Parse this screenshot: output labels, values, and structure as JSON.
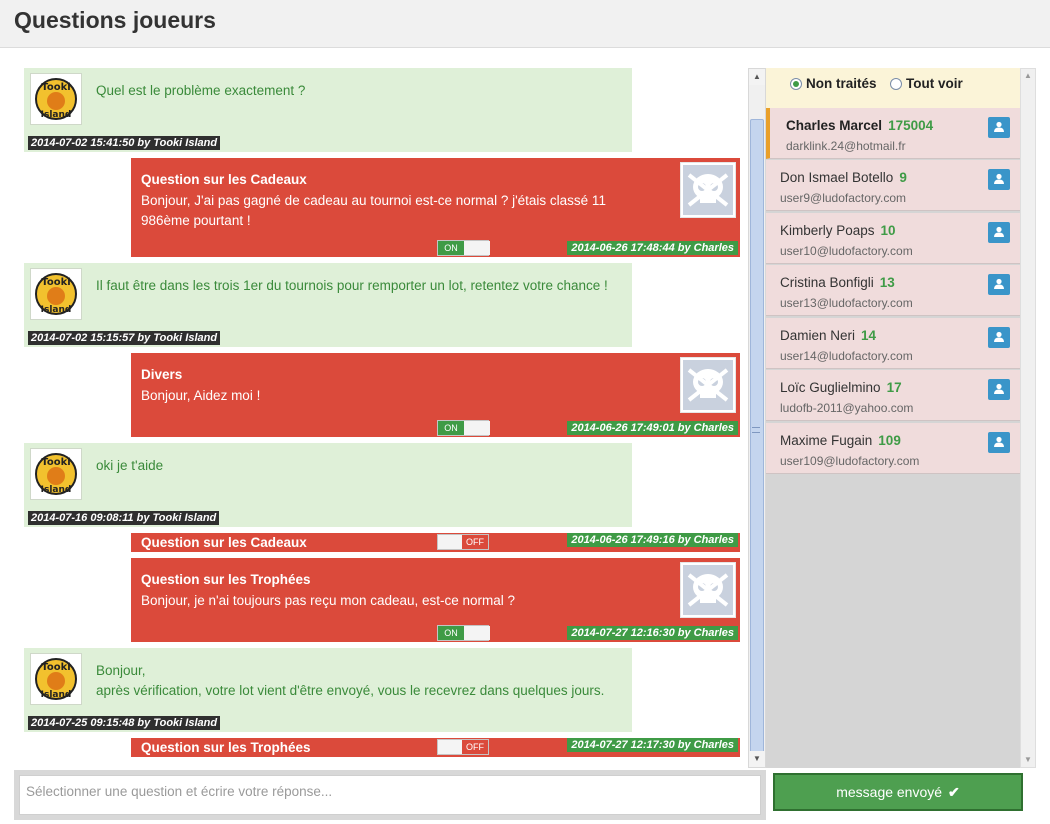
{
  "header": {
    "title": "Questions joueurs"
  },
  "admin_avatar_text": [
    "Tooki",
    "Island"
  ],
  "messages": [
    {
      "kind": "admin",
      "text": "Quel est le problème exactement ?",
      "stamp": "2014-07-02 15:41:50 by Tooki Island"
    },
    {
      "kind": "user",
      "subject": "Question sur les Cadeaux",
      "body": "Bonjour, J'ai pas gagné de cadeau au tournoi est-ce normal ? j'étais classé 11 986ème pourtant !",
      "toggle": "ON",
      "stamp": "2014-06-26 17:48:44 by Charles"
    },
    {
      "kind": "admin",
      "text": "Il faut être dans les trois 1er du tournois pour remporter un lot, retentez votre chance !",
      "stamp": "2014-07-02 15:15:57 by Tooki Island"
    },
    {
      "kind": "user",
      "subject": "Divers",
      "body": "Bonjour, Aidez moi !",
      "toggle": "ON",
      "stamp": "2014-06-26 17:49:01 by Charles"
    },
    {
      "kind": "admin",
      "text": "oki je t'aide",
      "stamp": "2014-07-16 09:08:11 by Tooki Island"
    },
    {
      "kind": "collapsed",
      "subject": "Question sur les Cadeaux",
      "toggle": "OFF",
      "stamp": "2014-06-26 17:49:16 by Charles"
    },
    {
      "kind": "user",
      "subject": "Question sur les Trophées",
      "body": "Bonjour, je n'ai toujours pas reçu mon cadeau, est-ce normal ?",
      "toggle": "ON",
      "stamp": "2014-07-27 12:16:30 by Charles"
    },
    {
      "kind": "admin",
      "text": "Bonjour,\naprès vérification, votre lot vient d'être envoyé, vous le recevrez dans quelques jours.",
      "stamp": "2014-07-25 09:15:48 by Tooki Island"
    },
    {
      "kind": "collapsed",
      "subject": "Question sur les Trophées",
      "toggle": "OFF",
      "stamp": "2014-07-27 12:17:30 by Charles"
    }
  ],
  "filter": {
    "options": [
      "Non traités",
      "Tout voir"
    ],
    "selected": "Non traités"
  },
  "users": [
    {
      "name": "Charles Marcel",
      "count": "175004",
      "email": "darklink.24@hotmail.fr",
      "active": true
    },
    {
      "name": "Don Ismael Botello",
      "count": "9",
      "email": "user9@ludofactory.com",
      "active": false
    },
    {
      "name": "Kimberly Poaps",
      "count": "10",
      "email": "user10@ludofactory.com",
      "active": false
    },
    {
      "name": "Cristina Bonfigli",
      "count": "13",
      "email": "user13@ludofactory.com",
      "active": false
    },
    {
      "name": "Damien Neri",
      "count": "14",
      "email": "user14@ludofactory.com",
      "active": false
    },
    {
      "name": "Loïc Guglielmino",
      "count": "17",
      "email": "ludofb-2011@yahoo.com",
      "active": false
    },
    {
      "name": "Maxime Fugain",
      "count": "109",
      "email": "user109@ludofactory.com",
      "active": false
    }
  ],
  "reply": {
    "placeholder": "Sélectionner une question et écrire votre réponse...",
    "value": ""
  },
  "send_button": {
    "label": "message envoyé",
    "icon": "check-icon"
  },
  "colors": {
    "admin_bg": "#dff0d8",
    "admin_text": "#3a8a3a",
    "user_bg": "#db4a3b",
    "stamp_green": "#3f9b46",
    "user_row_bg": "#f0dcdc",
    "filter_bg": "#fbf4d8",
    "accent_blue": "#3a95c9"
  }
}
